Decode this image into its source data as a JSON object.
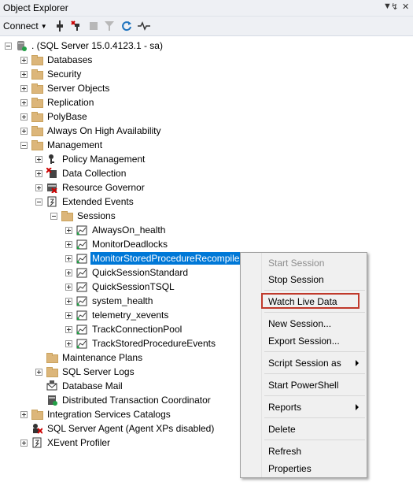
{
  "window": {
    "title": "Object Explorer",
    "title_icons": [
      "pin-icon",
      "dropdown-icon",
      "close-icon"
    ]
  },
  "toolbar": {
    "connect_label": "Connect",
    "buttons": [
      "connect-icon",
      "disconnect-icon",
      "stop-icon",
      "filter-icon",
      "refresh-icon",
      "activity-monitor-icon"
    ]
  },
  "tree": {
    "root": ". (SQL Server 15.0.4123.1 - sa)",
    "databases": "Databases",
    "security": "Security",
    "server_objects": "Server Objects",
    "replication": "Replication",
    "polybase": "PolyBase",
    "always_on": "Always On High Availability",
    "management": "Management",
    "policy_management": "Policy Management",
    "data_collection": "Data Collection",
    "resource_governor": "Resource Governor",
    "extended_events": "Extended Events",
    "sessions": "Sessions",
    "session_items": [
      "AlwaysOn_health",
      "MonitorDeadlocks",
      "MonitorStoredProcedureRecompile",
      "QuickSessionStandard",
      "QuickSessionTSQL",
      "system_health",
      "telemetry_xevents",
      "TrackConnectionPool",
      "TrackStoredProcedureEvents"
    ],
    "maintenance_plans": "Maintenance Plans",
    "sql_server_logs": "SQL Server Logs",
    "database_mail": "Database Mail",
    "distributed_tx": "Distributed Transaction Coordinator",
    "integration_services": "Integration Services Catalogs",
    "sql_agent": "SQL Server Agent (Agent XPs disabled)",
    "xevent_profiler": "XEvent Profiler"
  },
  "context_menu": {
    "start_session": "Start Session",
    "stop_session": "Stop Session",
    "watch_live_data": "Watch Live Data",
    "new_session": "New Session...",
    "export_session": "Export Session...",
    "script_session_as": "Script Session as",
    "start_powershell": "Start PowerShell",
    "reports": "Reports",
    "delete": "Delete",
    "refresh": "Refresh",
    "properties": "Properties"
  },
  "colors": {
    "selection": "#0078d7",
    "highlight_box": "#c0392b",
    "folder": "#dcb67a"
  }
}
